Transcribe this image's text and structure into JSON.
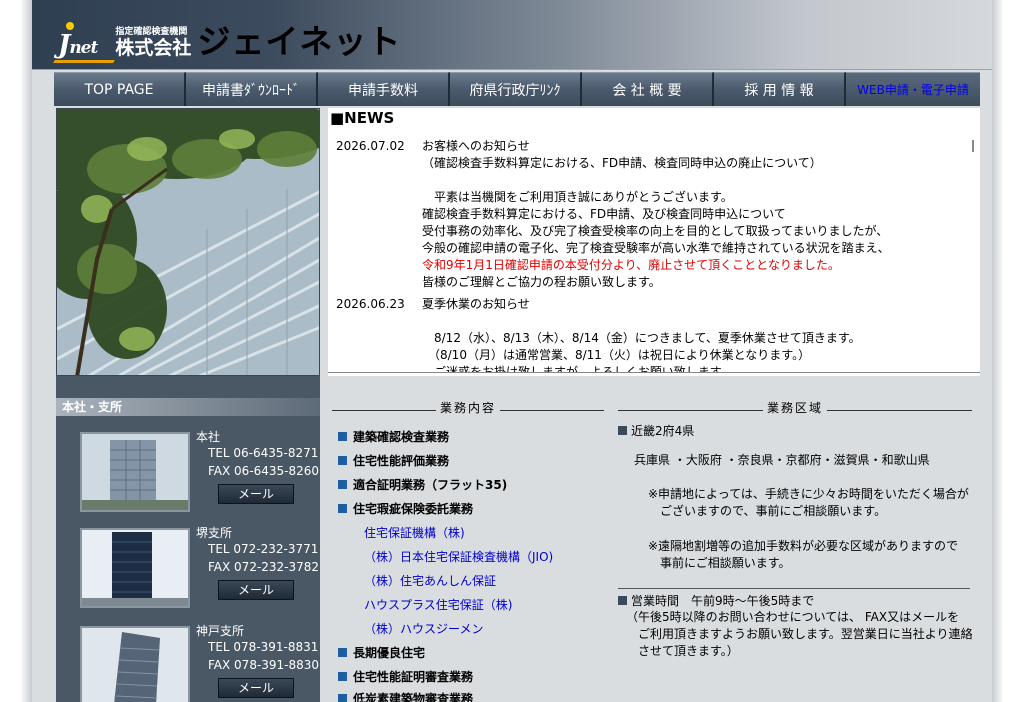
{
  "header": {
    "logo_j": "J",
    "logo_net": "net",
    "logo_sub": "指定確認検査機関",
    "logo_corp": "株式会社",
    "logo_name": "ジェイネット"
  },
  "nav": {
    "items": [
      {
        "label": "TOP PAGE"
      },
      {
        "label": "申請書ﾀﾞｳﾝﾛｰﾄﾞ"
      },
      {
        "label": "申請手数料"
      },
      {
        "label": "府県行政庁ﾘﾝｸ"
      },
      {
        "label": "会 社 概 要"
      },
      {
        "label": "採 用 情 報"
      },
      {
        "label": "WEB申請・電子申請"
      }
    ]
  },
  "news": {
    "title": "■NEWS",
    "entries": [
      {
        "date": "2026.07.02",
        "lines": [
          "お客様へのお知らせ",
          "（確認検査手数料算定における、FD申請、検査同時申込の廃止について）",
          "",
          "　平素は当機関をご利用頂き誠にありがとうございます。",
          "確認検査手数料算定における、FD申請、及び検査同時申込について",
          "受付事務の効率化、及び完了検査受検率の向上を目的として取扱ってまいりましたが、",
          "今般の確認申請の電子化、完了検査受験率が高い水準で維持されている状況を踏まえ、",
          "令和9年1月1日確認申請の本受付分より、廃止させて頂くこととなりました。",
          "皆様のご理解とご協力の程お願い致します。"
        ]
      },
      {
        "date": "2026.06.23",
        "lines": [
          "夏季休業のお知らせ",
          "",
          "　8/12（水）、8/13（木）、8/14（金）につきまして、夏季休業させて頂きます。",
          "　（8/10（月）は通常営業、8/11（火）は祝日により休業となります。）",
          "　ご迷惑をお掛け致しますが、よろしくお願い致します。"
        ]
      }
    ]
  },
  "offices": {
    "section_title": "本社・支所",
    "items": [
      {
        "name": "本社",
        "tel": "TEL 06-6435-8271",
        "fax": "FAX 06-6435-8260",
        "mail": "メール"
      },
      {
        "name": "堺支所",
        "tel": "TEL 072-232-3771",
        "fax": "FAX 072-232-3782",
        "mail": "メール"
      },
      {
        "name": "神戸支所",
        "tel": "TEL 078-391-8831",
        "fax": "FAX 078-391-8830",
        "mail": "メール"
      }
    ]
  },
  "services": {
    "heading": "業務内容",
    "items": [
      {
        "label": "建築確認検査業務",
        "type": "main"
      },
      {
        "label": "住宅性能評価業務",
        "type": "main"
      },
      {
        "label": "適合証明業務（フラット35)",
        "type": "main"
      },
      {
        "label": "住宅瑕疵保険委託業務",
        "type": "main"
      },
      {
        "label": "住宅保証機構（株)",
        "type": "link"
      },
      {
        "label": "（株）日本住宅保証検査機構（JIO)",
        "type": "link"
      },
      {
        "label": "（株）住宅あんしん保証",
        "type": "link"
      },
      {
        "label": "ハウスプラス住宅保証（株)",
        "type": "link"
      },
      {
        "label": "（株）ハウスジーメン",
        "type": "link"
      },
      {
        "label": "長期優良住宅",
        "type": "main"
      },
      {
        "label": "住宅性能証明審査業務",
        "type": "main"
      },
      {
        "label": "低炭素建築物審査業務",
        "type": "main"
      }
    ]
  },
  "area": {
    "heading": "業務区域",
    "region": "近畿2府4県",
    "prefectures": "兵庫県 ・大阪府 ・奈良県・京都府・滋賀県・和歌山県",
    "note1_line1": "※申請地によっては、手続きに少々お時間をいただく場合が",
    "note1_line2": "　ございますので、事前にご相談願います。",
    "note2_line1": "※遠隔地割増等の追加手数料が必要な区域がありますので",
    "note2_line2": "　事前にご相談願います。",
    "hours": "営業時間　午前9時～午後5時まで",
    "hours_note1": "（午後5時以降のお問い合わせについては、 FAX又はメールを",
    "hours_note2": "　ご利用頂きますようお願い致します。翌営業日に当社より連絡",
    "hours_note3": "　させて頂きます。）"
  }
}
